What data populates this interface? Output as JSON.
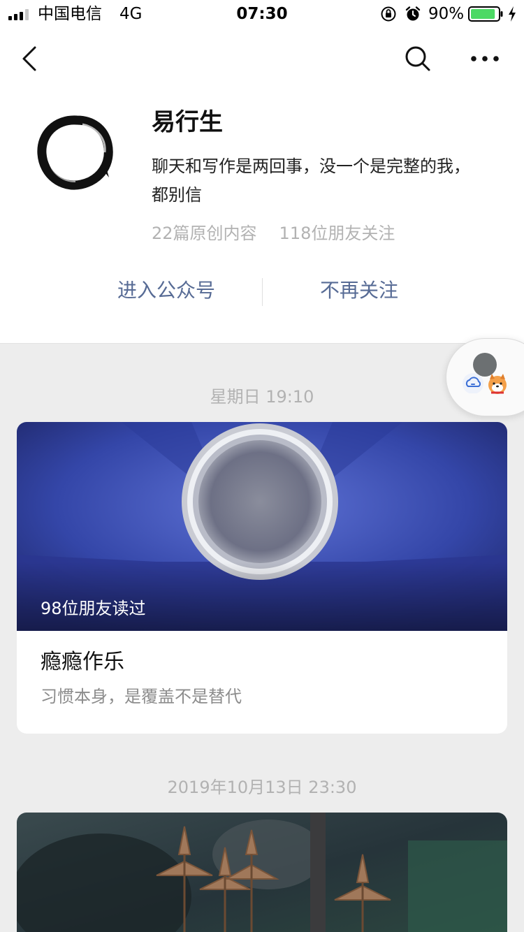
{
  "status_bar": {
    "carrier": "中国电信",
    "network": "4G",
    "time": "07:30",
    "battery_percent": "90%",
    "battery_level": 0.9,
    "icons": [
      "signal-icon",
      "lock-rotation-icon",
      "alarm-icon",
      "battery-icon",
      "charging-icon"
    ]
  },
  "nav": {
    "icons": [
      "back-icon",
      "search-icon",
      "more-icon"
    ]
  },
  "profile": {
    "name": "易行生",
    "bio": "聊天和写作是两回事，没一个是完整的我，都别信",
    "stats": {
      "original_articles": "22篇原创内容",
      "followers": "118位朋友关注"
    },
    "actions": {
      "enter": "进入公众号",
      "unfollow": "不再关注"
    }
  },
  "feed": {
    "items": [
      {
        "timestamp": "星期日 19:10",
        "read_by": "98位朋友读过",
        "title": "瘾瘾作乐",
        "digest": "习惯本身，是覆盖不是替代"
      },
      {
        "timestamp": "2019年10月13日 23:30"
      }
    ]
  },
  "colors": {
    "link_blue": "#576b95",
    "battery_green": "#4cd964",
    "background": "#ededed"
  }
}
